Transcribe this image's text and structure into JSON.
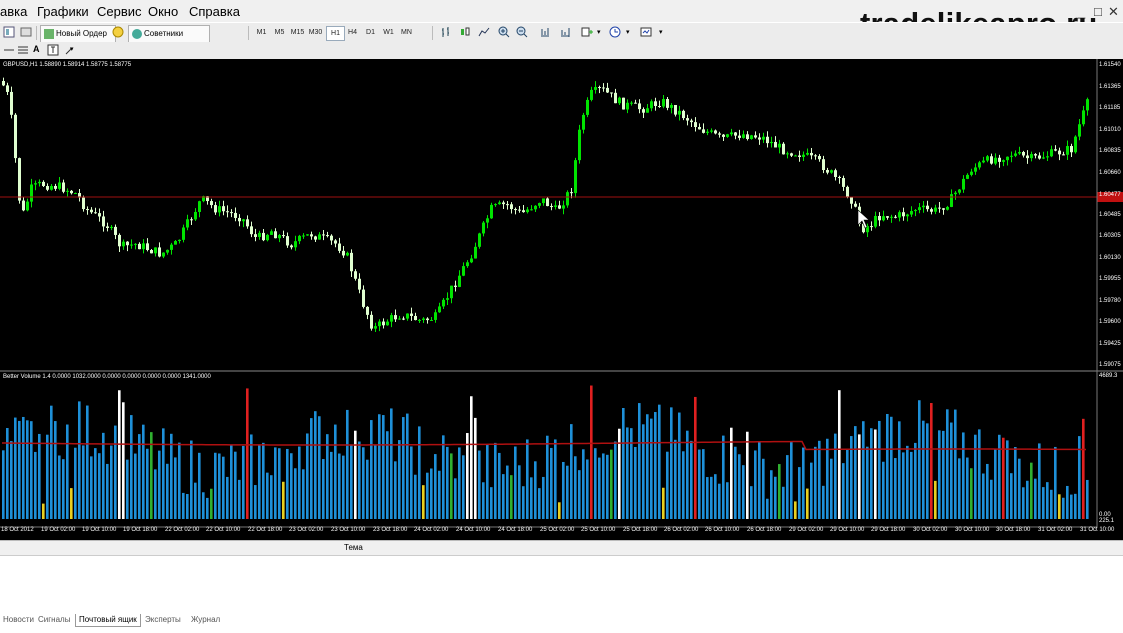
{
  "menu": [
    "авка",
    "Графики",
    "Сервис",
    "Окно",
    "Справка"
  ],
  "watermark": "tradelikeapro.ru",
  "toolbar": {
    "new_order": "Новый Ордер",
    "experts": "Советники"
  },
  "timeframes": [
    "M1",
    "M5",
    "M15",
    "M30",
    "H1",
    "H4",
    "D1",
    "W1",
    "MN"
  ],
  "active_timeframe": "H1",
  "chart": {
    "title": "GBPUSD,H1  1.58890 1.58914 1.58775 1.58775",
    "indicator_title": "Better Volume 1.4 0.0000 1032.0000 0.0000 0.0000 0.0000 0.0000 1341.0000",
    "price_labels": [
      "1.61540",
      "1.61365",
      "1.61185",
      "1.61010",
      "1.60835",
      "1.60660",
      "1.60485",
      "1.60305",
      "1.60130",
      "1.59955",
      "1.59780",
      "1.59600",
      "1.59425",
      "1.59250",
      "1.59075"
    ],
    "current_price_label": "1.60477",
    "volume_labels": [
      "4689.3",
      "0.00",
      "225.1"
    ],
    "date_labels": [
      "18 Oct 2012",
      "19 Oct 02:00",
      "19 Oct 10:00",
      "19 Oct 18:00",
      "22 Oct 02:00",
      "22 Oct 10:00",
      "22 Oct 18:00",
      "23 Oct 02:00",
      "23 Oct 10:00",
      "23 Oct 18:00",
      "24 Oct 02:00",
      "24 Oct 10:00",
      "24 Oct 18:00",
      "25 Oct 02:00",
      "25 Oct 10:00",
      "25 Oct 18:00",
      "26 Oct 02:00",
      "26 Oct 10:00",
      "26 Oct 18:00",
      "29 Oct 02:00",
      "29 Oct 10:00",
      "29 Oct 18:00",
      "30 Oct 02:00",
      "30 Oct 10:00",
      "30 Oct 18:00",
      "31 Oct 02:00",
      "31 Oct 10:00"
    ]
  },
  "terminal": {
    "column_header": "Тема",
    "tabs": [
      "Новости",
      "Сигналы",
      "Почтовый ящик",
      "Эксперты",
      "Журнал"
    ],
    "active_tab": "Почтовый ящик"
  },
  "colors": {
    "bull": "#00e400",
    "bear": "#e0ffd0",
    "volume": "#1e90d8",
    "high_volume": "#ffffff",
    "climax": "#e02020",
    "churn": "#30b030",
    "low_volume": "#e8d020",
    "ma": "#b01010"
  }
}
